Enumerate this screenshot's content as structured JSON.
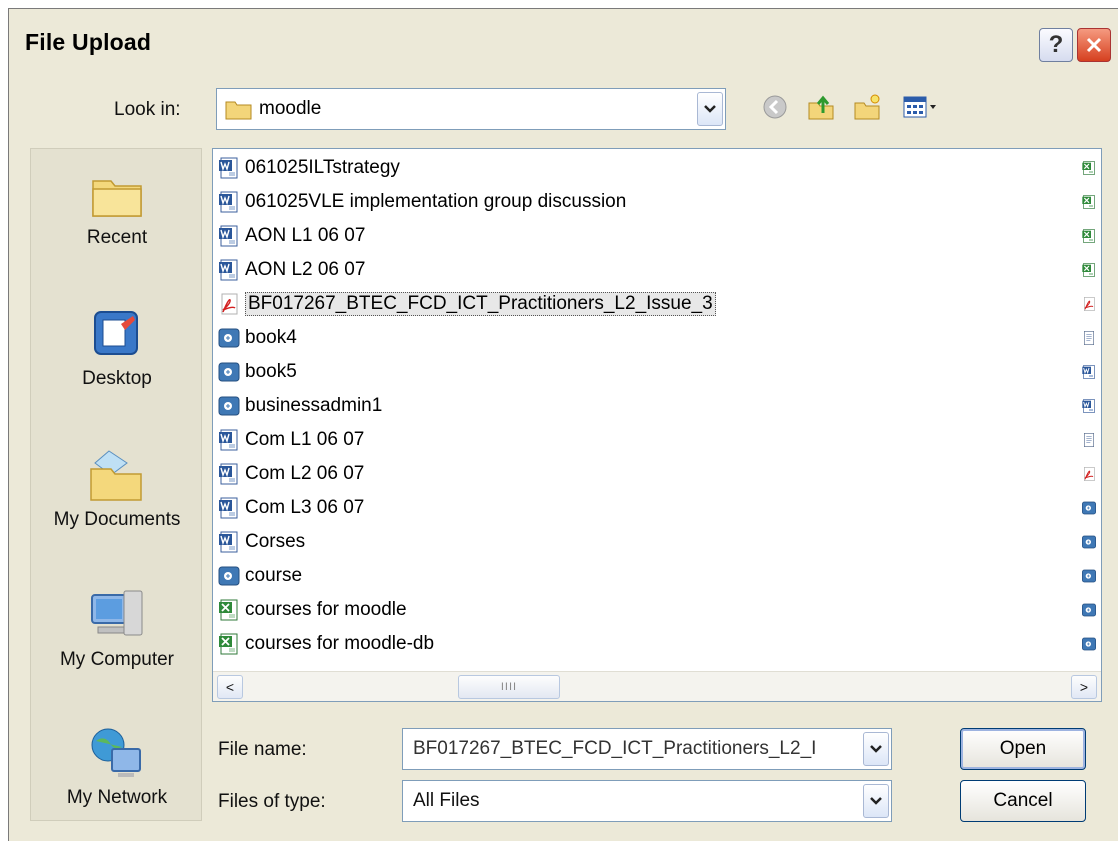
{
  "dialog": {
    "title": "File Upload",
    "help_symbol": "?",
    "close_symbol": "X"
  },
  "lookin": {
    "label": "Look in:",
    "value": "moodle"
  },
  "places": [
    {
      "label": "Recent",
      "icon": "folder-icon"
    },
    {
      "label": "Desktop",
      "icon": "desktop-icon"
    },
    {
      "label": "My Documents",
      "icon": "documents-folder-icon"
    },
    {
      "label": "My Computer",
      "icon": "computer-icon"
    },
    {
      "label": "My Network",
      "icon": "network-icon"
    }
  ],
  "files": [
    {
      "name": "061025ILTstrategy",
      "type": "word"
    },
    {
      "name": "061025VLE implementation group discussion",
      "type": "word"
    },
    {
      "name": "AON L1 06 07",
      "type": "word"
    },
    {
      "name": "AON L2 06 07",
      "type": "word"
    },
    {
      "name": "BF017267_BTEC_FCD_ICT_Practitioners_L2_Issue_3",
      "type": "pdf",
      "selected": true
    },
    {
      "name": "book4",
      "type": "image"
    },
    {
      "name": "book5",
      "type": "image"
    },
    {
      "name": "businessadmin1",
      "type": "image"
    },
    {
      "name": "Com L1 06 07",
      "type": "word"
    },
    {
      "name": "Com L2 06 07",
      "type": "word"
    },
    {
      "name": "Com L3 06 07",
      "type": "word"
    },
    {
      "name": "Corses",
      "type": "word"
    },
    {
      "name": "course",
      "type": "image"
    },
    {
      "name": "courses for moodle",
      "type": "excel"
    },
    {
      "name": "courses for moodle-db",
      "type": "excel"
    }
  ],
  "right_column_icons": [
    "excel",
    "excel",
    "excel",
    "excel",
    "pdf",
    "generic",
    "word",
    "word",
    "generic",
    "pdf",
    "image",
    "image",
    "image",
    "image",
    "image"
  ],
  "scrollbar": {
    "thumb_grip": "IIII",
    "left_arrow": "<",
    "right_arrow": ">"
  },
  "file_name": {
    "label": "File name:",
    "value": "BF017267_BTEC_FCD_ICT_Practitioners_L2_I"
  },
  "file_type": {
    "label": "Files of type:",
    "value": "All Files"
  },
  "buttons": {
    "open": "Open",
    "cancel": "Cancel"
  },
  "colors": {
    "dialog_bg": "#ece9d8",
    "close_red": "#d6401f",
    "border_blue": "#7f9db9"
  }
}
